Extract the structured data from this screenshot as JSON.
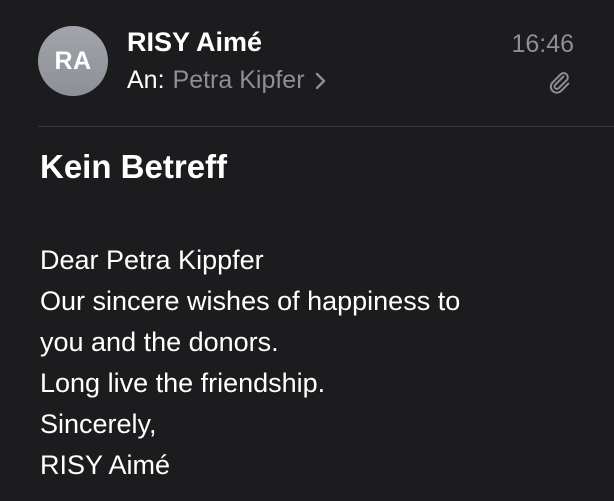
{
  "header": {
    "avatar_initials": "RA",
    "sender_name": "RISY Aimé",
    "recipient_prefix": "An:",
    "recipient_name": "Petra Kipfer",
    "time": "16:46",
    "icons": {
      "chevron": "chevron-right-icon",
      "attachment": "paperclip-icon"
    },
    "colors": {
      "background": "#1c1c1e",
      "avatar": "#9a9ca3",
      "secondary_text": "#8e8e93",
      "divider": "#3a3a3c"
    }
  },
  "message": {
    "subject": "Kein Betreff",
    "body_lines": [
      "Dear Petra Kippfer",
      "Our sincere wishes of happiness to",
      "you and the donors.",
      "Long live the friendship.",
      "Sincerely,",
      "RISY Aimé"
    ]
  }
}
